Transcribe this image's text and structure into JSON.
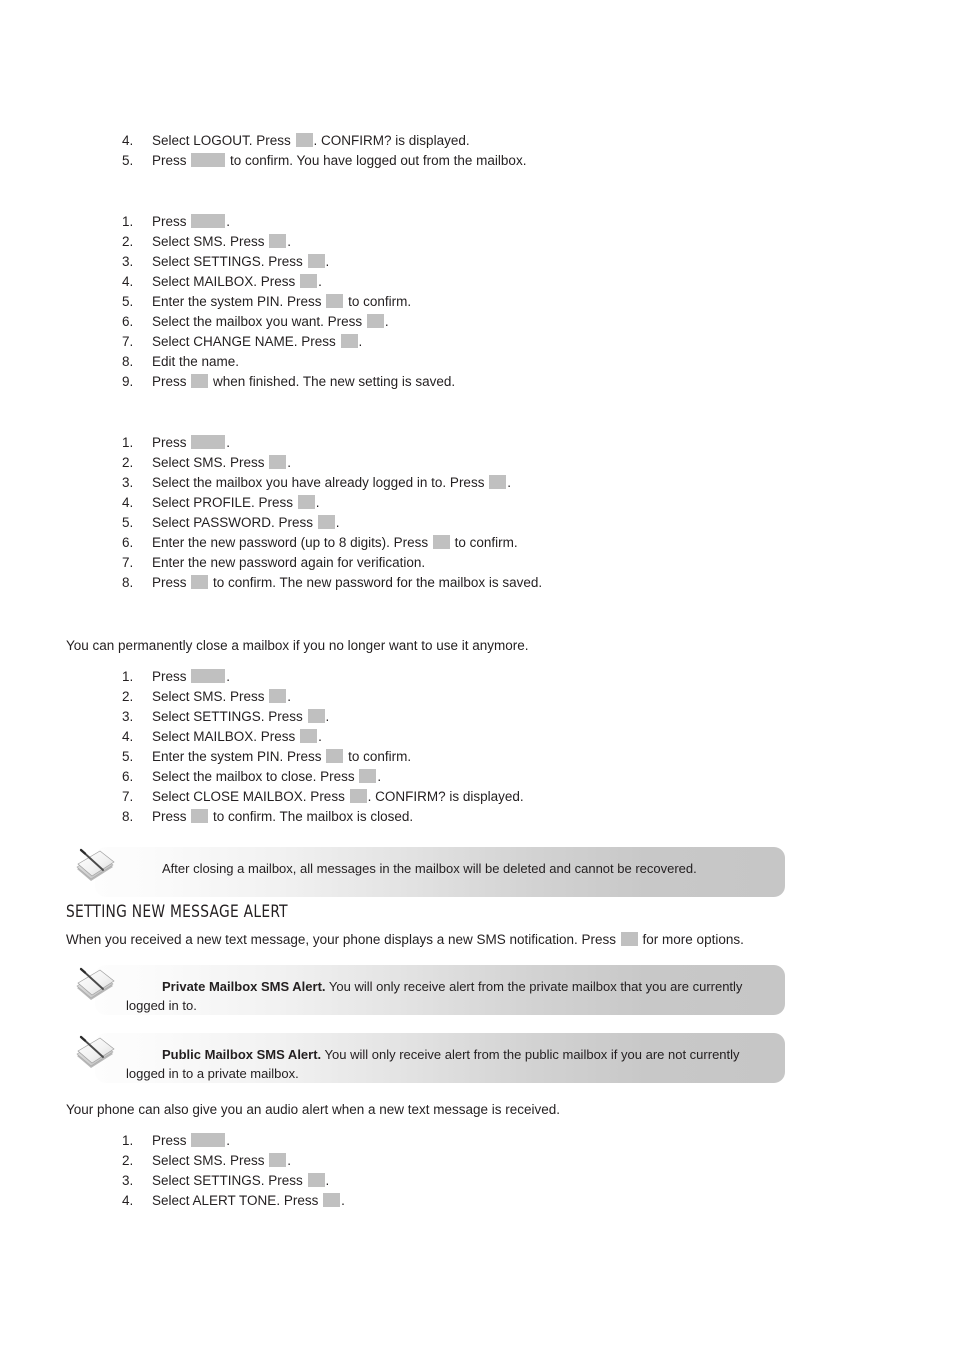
{
  "document": {
    "type": "phone-user-manual-page"
  },
  "blocks": {
    "logout_steps": [
      {
        "num": "4.",
        "parts": [
          {
            "t": "text",
            "v": "Select LOGOUT. Press "
          },
          {
            "t": "key",
            "v": "narrow"
          },
          {
            "t": "text",
            "v": ". CONFIRM? is displayed."
          }
        ]
      },
      {
        "num": "5.",
        "parts": [
          {
            "t": "text",
            "v": "Press "
          },
          {
            "t": "key",
            "v": "wide"
          },
          {
            "t": "text",
            "v": " to confirm. You have logged out from the mailbox."
          }
        ]
      }
    ],
    "change_name_steps": [
      {
        "num": "1.",
        "parts": [
          {
            "t": "text",
            "v": "Press "
          },
          {
            "t": "key",
            "v": "wide"
          },
          {
            "t": "text",
            "v": "."
          }
        ]
      },
      {
        "num": "2.",
        "parts": [
          {
            "t": "text",
            "v": "Select SMS. Press "
          },
          {
            "t": "key",
            "v": "narrow"
          },
          {
            "t": "text",
            "v": "."
          }
        ]
      },
      {
        "num": "3.",
        "parts": [
          {
            "t": "text",
            "v": "Select SETTINGS. Press "
          },
          {
            "t": "key",
            "v": "narrow"
          },
          {
            "t": "text",
            "v": "."
          }
        ]
      },
      {
        "num": "4.",
        "parts": [
          {
            "t": "text",
            "v": "Select MAILBOX. Press "
          },
          {
            "t": "key",
            "v": "narrow"
          },
          {
            "t": "text",
            "v": "."
          }
        ]
      },
      {
        "num": "5.",
        "parts": [
          {
            "t": "text",
            "v": "Enter the system PIN. Press "
          },
          {
            "t": "key",
            "v": "narrow"
          },
          {
            "t": "text",
            "v": " to confirm."
          }
        ]
      },
      {
        "num": "6.",
        "parts": [
          {
            "t": "text",
            "v": "Select the mailbox you want. Press "
          },
          {
            "t": "key",
            "v": "narrow"
          },
          {
            "t": "text",
            "v": "."
          }
        ]
      },
      {
        "num": "7.",
        "parts": [
          {
            "t": "text",
            "v": "Select CHANGE NAME. Press "
          },
          {
            "t": "key",
            "v": "narrow"
          },
          {
            "t": "text",
            "v": "."
          }
        ]
      },
      {
        "num": "8.",
        "parts": [
          {
            "t": "text",
            "v": "Edit the name."
          }
        ]
      },
      {
        "num": "9.",
        "parts": [
          {
            "t": "text",
            "v": "Press "
          },
          {
            "t": "key",
            "v": "narrow"
          },
          {
            "t": "text",
            "v": " when finished. The new setting is saved."
          }
        ]
      }
    ],
    "change_password_steps": [
      {
        "num": "1.",
        "parts": [
          {
            "t": "text",
            "v": "Press "
          },
          {
            "t": "key",
            "v": "wide"
          },
          {
            "t": "text",
            "v": "."
          }
        ]
      },
      {
        "num": "2.",
        "parts": [
          {
            "t": "text",
            "v": "Select SMS. Press "
          },
          {
            "t": "key",
            "v": "narrow"
          },
          {
            "t": "text",
            "v": "."
          }
        ]
      },
      {
        "num": "3.",
        "parts": [
          {
            "t": "text",
            "v": "Select the mailbox you have already logged in to. Press "
          },
          {
            "t": "key",
            "v": "narrow"
          },
          {
            "t": "text",
            "v": "."
          }
        ]
      },
      {
        "num": "4.",
        "parts": [
          {
            "t": "text",
            "v": "Select PROFILE. Press "
          },
          {
            "t": "key",
            "v": "narrow"
          },
          {
            "t": "text",
            "v": "."
          }
        ]
      },
      {
        "num": "5.",
        "parts": [
          {
            "t": "text",
            "v": "Select PASSWORD. Press "
          },
          {
            "t": "key",
            "v": "narrow"
          },
          {
            "t": "text",
            "v": "."
          }
        ]
      },
      {
        "num": "6.",
        "parts": [
          {
            "t": "text",
            "v": "Enter the new password (up to 8 digits). Press "
          },
          {
            "t": "key",
            "v": "narrow"
          },
          {
            "t": "text",
            "v": " to confirm."
          }
        ]
      },
      {
        "num": "7.",
        "parts": [
          {
            "t": "text",
            "v": "Enter the new password again for verification."
          }
        ]
      },
      {
        "num": "8.",
        "parts": [
          {
            "t": "text",
            "v": "Press "
          },
          {
            "t": "key",
            "v": "narrow"
          },
          {
            "t": "text",
            "v": " to confirm. The new password for the mailbox is saved."
          }
        ]
      }
    ],
    "close_mailbox_intro": "You can permanently close a mailbox if you no longer want to use it anymore.",
    "close_mailbox_steps": [
      {
        "num": "1.",
        "parts": [
          {
            "t": "text",
            "v": "Press "
          },
          {
            "t": "key",
            "v": "wide"
          },
          {
            "t": "text",
            "v": "."
          }
        ]
      },
      {
        "num": "2.",
        "parts": [
          {
            "t": "text",
            "v": "Select SMS. Press "
          },
          {
            "t": "key",
            "v": "narrow"
          },
          {
            "t": "text",
            "v": "."
          }
        ]
      },
      {
        "num": "3.",
        "parts": [
          {
            "t": "text",
            "v": "Select SETTINGS. Press "
          },
          {
            "t": "key",
            "v": "narrow"
          },
          {
            "t": "text",
            "v": "."
          }
        ]
      },
      {
        "num": "4.",
        "parts": [
          {
            "t": "text",
            "v": "Select MAILBOX. Press "
          },
          {
            "t": "key",
            "v": "narrow"
          },
          {
            "t": "text",
            "v": "."
          }
        ]
      },
      {
        "num": "5.",
        "parts": [
          {
            "t": "text",
            "v": "Enter the system PIN. Press "
          },
          {
            "t": "key",
            "v": "narrow"
          },
          {
            "t": "text",
            "v": " to confirm."
          }
        ]
      },
      {
        "num": "6.",
        "parts": [
          {
            "t": "text",
            "v": "Select the mailbox to close. Press "
          },
          {
            "t": "key",
            "v": "narrow"
          },
          {
            "t": "text",
            "v": "."
          }
        ]
      },
      {
        "num": "7.",
        "parts": [
          {
            "t": "text",
            "v": "Select CLOSE MAILBOX. Press "
          },
          {
            "t": "key",
            "v": "narrow"
          },
          {
            "t": "text",
            "v": ". CONFIRM? is displayed."
          }
        ]
      },
      {
        "num": "8.",
        "parts": [
          {
            "t": "text",
            "v": "Press "
          },
          {
            "t": "key",
            "v": "narrow"
          },
          {
            "t": "text",
            "v": " to confirm. The mailbox is closed."
          }
        ]
      }
    ],
    "note_close_mailbox": {
      "lead": "",
      "text": "After closing a mailbox, all messages in the mailbox will be deleted and cannot be recovered."
    },
    "section_heading": "SETTING NEW MESSAGE ALERT",
    "new_message_intro": {
      "before": "When you received a new text message, your phone displays a new SMS notification. Press ",
      "after": " for more options."
    },
    "note_private": {
      "lead": "Private Mailbox SMS Alert.",
      "text": " You will only receive alert from the private mailbox that you are currently logged in to."
    },
    "note_public": {
      "lead": "Public Mailbox SMS Alert.",
      "text": " You will only receive alert from the public mailbox if you are not currently logged in to a private mailbox."
    },
    "audio_alert_intro": "Your phone can also give you an audio alert when a new text message is received.",
    "alert_tone_steps": [
      {
        "num": "1.",
        "parts": [
          {
            "t": "text",
            "v": "Press "
          },
          {
            "t": "key",
            "v": "wide"
          },
          {
            "t": "text",
            "v": "."
          }
        ]
      },
      {
        "num": "2.",
        "parts": [
          {
            "t": "text",
            "v": "Select SMS. Press "
          },
          {
            "t": "key",
            "v": "narrow"
          },
          {
            "t": "text",
            "v": "."
          }
        ]
      },
      {
        "num": "3.",
        "parts": [
          {
            "t": "text",
            "v": "Select SETTINGS. Press "
          },
          {
            "t": "key",
            "v": "narrow"
          },
          {
            "t": "text",
            "v": "."
          }
        ]
      },
      {
        "num": "4.",
        "parts": [
          {
            "t": "text",
            "v": "Select ALERT TONE. Press "
          },
          {
            "t": "key",
            "v": "narrow"
          },
          {
            "t": "text",
            "v": "."
          }
        ]
      }
    ]
  },
  "icons": {
    "note": "note-paper-pen-icon"
  },
  "colors": {
    "text": "#231f20",
    "key_placeholder": "#c0c0c0",
    "note_gradient_start": "#fdfdfd",
    "note_gradient_end": "#c6c6c6"
  }
}
